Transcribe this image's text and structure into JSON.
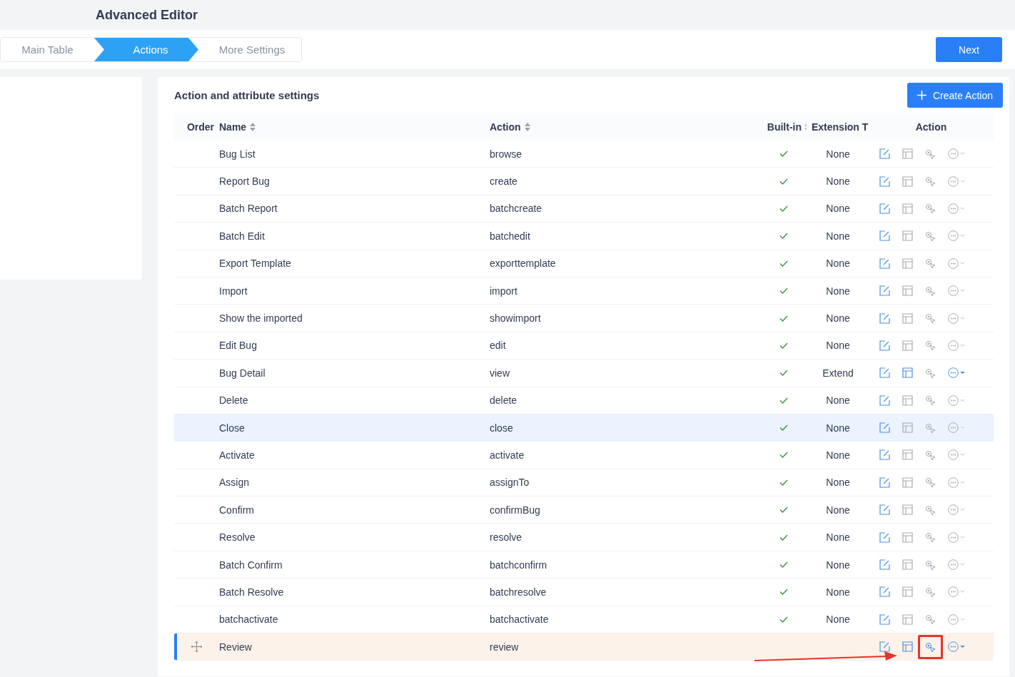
{
  "page_title": "Advanced Editor",
  "steps": [
    {
      "label": "Main Table",
      "selected": false
    },
    {
      "label": "Actions",
      "selected": true
    },
    {
      "label": "More Settings",
      "selected": false
    }
  ],
  "next_button": "Next",
  "panel": {
    "title": "Action and attribute settings",
    "create_button": "Create Action",
    "columns": [
      "Order",
      "Name",
      "Action",
      "Built-in",
      "Extension T",
      "Action"
    ],
    "rows": [
      {
        "name": "Bug List",
        "action": "browse",
        "built_in": true,
        "extension": "None",
        "layout_active": false,
        "more_active": false,
        "workflow_active": false,
        "hovered": false,
        "selected": false,
        "highlighted": false
      },
      {
        "name": "Report Bug",
        "action": "create",
        "built_in": true,
        "extension": "None",
        "layout_active": false,
        "more_active": false,
        "workflow_active": false,
        "hovered": false,
        "selected": false,
        "highlighted": false
      },
      {
        "name": "Batch Report",
        "action": "batchcreate",
        "built_in": true,
        "extension": "None",
        "layout_active": false,
        "more_active": false,
        "workflow_active": false,
        "hovered": false,
        "selected": false,
        "highlighted": false
      },
      {
        "name": "Batch Edit",
        "action": "batchedit",
        "built_in": true,
        "extension": "None",
        "layout_active": false,
        "more_active": false,
        "workflow_active": false,
        "hovered": false,
        "selected": false,
        "highlighted": false
      },
      {
        "name": "Export Template",
        "action": "exporttemplate",
        "built_in": true,
        "extension": "None",
        "layout_active": false,
        "more_active": false,
        "workflow_active": false,
        "hovered": false,
        "selected": false,
        "highlighted": false
      },
      {
        "name": "Import",
        "action": "import",
        "built_in": true,
        "extension": "None",
        "layout_active": false,
        "more_active": false,
        "workflow_active": false,
        "hovered": false,
        "selected": false,
        "highlighted": false
      },
      {
        "name": "Show the imported",
        "action": "showimport",
        "built_in": true,
        "extension": "None",
        "layout_active": false,
        "more_active": false,
        "workflow_active": false,
        "hovered": false,
        "selected": false,
        "highlighted": false
      },
      {
        "name": "Edit Bug",
        "action": "edit",
        "built_in": true,
        "extension": "None",
        "layout_active": false,
        "more_active": false,
        "workflow_active": false,
        "hovered": false,
        "selected": false,
        "highlighted": false
      },
      {
        "name": "Bug Detail",
        "action": "view",
        "built_in": true,
        "extension": "Extend",
        "layout_active": true,
        "more_active": true,
        "workflow_active": false,
        "hovered": false,
        "selected": false,
        "highlighted": false
      },
      {
        "name": "Delete",
        "action": "delete",
        "built_in": true,
        "extension": "None",
        "layout_active": false,
        "more_active": false,
        "workflow_active": false,
        "hovered": false,
        "selected": false,
        "highlighted": false
      },
      {
        "name": "Close",
        "action": "close",
        "built_in": true,
        "extension": "None",
        "layout_active": false,
        "more_active": false,
        "workflow_active": false,
        "hovered": true,
        "selected": false,
        "highlighted": false
      },
      {
        "name": "Activate",
        "action": "activate",
        "built_in": true,
        "extension": "None",
        "layout_active": false,
        "more_active": false,
        "workflow_active": false,
        "hovered": false,
        "selected": false,
        "highlighted": false
      },
      {
        "name": "Assign",
        "action": "assignTo",
        "built_in": true,
        "extension": "None",
        "layout_active": false,
        "more_active": false,
        "workflow_active": false,
        "hovered": false,
        "selected": false,
        "highlighted": false
      },
      {
        "name": "Confirm",
        "action": "confirmBug",
        "built_in": true,
        "extension": "None",
        "layout_active": false,
        "more_active": false,
        "workflow_active": false,
        "hovered": false,
        "selected": false,
        "highlighted": false
      },
      {
        "name": "Resolve",
        "action": "resolve",
        "built_in": true,
        "extension": "None",
        "layout_active": false,
        "more_active": false,
        "workflow_active": false,
        "hovered": false,
        "selected": false,
        "highlighted": false
      },
      {
        "name": "Batch Confirm",
        "action": "batchconfirm",
        "built_in": true,
        "extension": "None",
        "layout_active": false,
        "more_active": false,
        "workflow_active": false,
        "hovered": false,
        "selected": false,
        "highlighted": false
      },
      {
        "name": "Batch Resolve",
        "action": "batchresolve",
        "built_in": true,
        "extension": "None",
        "layout_active": false,
        "more_active": false,
        "workflow_active": false,
        "hovered": false,
        "selected": false,
        "highlighted": false
      },
      {
        "name": "batchactivate",
        "action": "batchactivate",
        "built_in": true,
        "extension": "None",
        "layout_active": false,
        "more_active": false,
        "workflow_active": false,
        "hovered": false,
        "selected": false,
        "highlighted": false
      },
      {
        "name": "Review",
        "action": "review",
        "built_in": false,
        "layout_active": true,
        "more_active": true,
        "workflow_active": true,
        "hovered": false,
        "selected": true,
        "highlighted": true
      }
    ]
  }
}
